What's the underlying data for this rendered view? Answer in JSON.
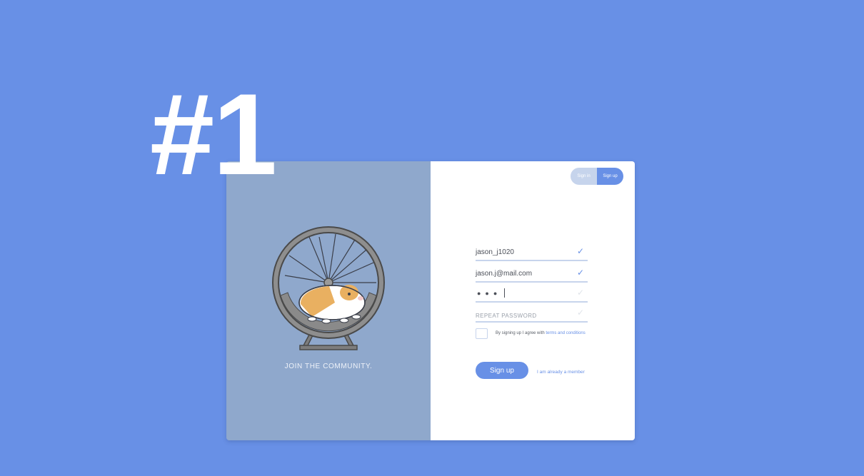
{
  "page": {
    "background_color": "#6890e6",
    "accent_color": "#6890e6"
  },
  "headline": {
    "text": "#1"
  },
  "left_panel": {
    "background_color": "#8fa8cc",
    "illustration": "hamster-wheel-guinea-pig-icon",
    "caption": "JOIN THE COMMUNITY."
  },
  "toggle": {
    "signin_label": "Sign in",
    "signup_label": "Sign up",
    "active": "Sign up"
  },
  "form": {
    "username": {
      "value": "jason_j1020",
      "valid": true
    },
    "email": {
      "value": "jason.j@mail.com",
      "valid": true
    },
    "password": {
      "masked": "●●●",
      "valid": false
    },
    "repeat_password": {
      "placeholder": "REPEAT PASSWORD",
      "valid": false
    },
    "terms": {
      "checked": false,
      "prefix": "By signing up I agree with",
      "link": "terms and conditions"
    },
    "submit_label": "Sign up",
    "member_link": "I am already a member"
  }
}
